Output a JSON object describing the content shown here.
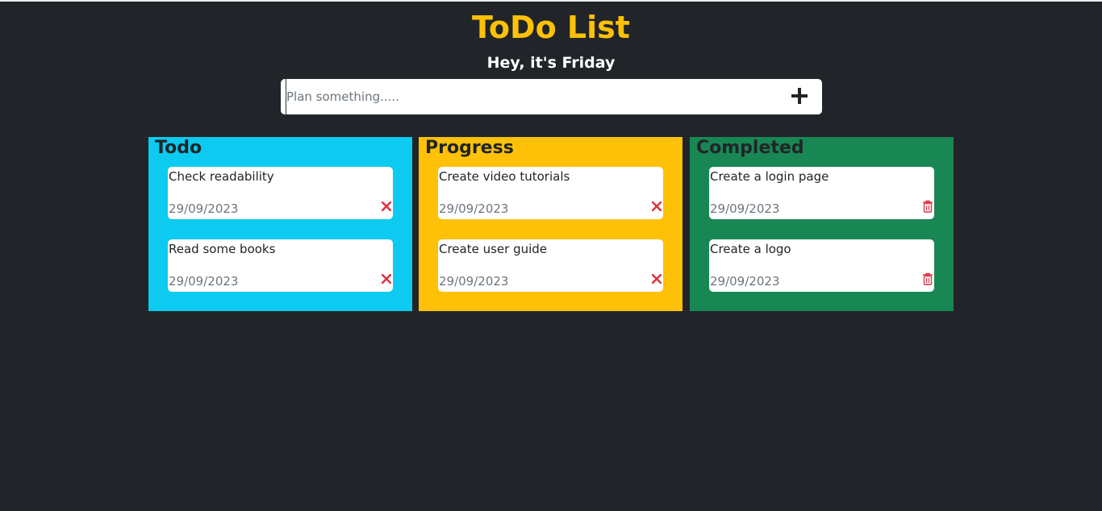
{
  "header": {
    "title": "ToDo List",
    "subtitle": "Hey, it's Friday"
  },
  "add_task": {
    "placeholder": "Plan something.....",
    "value": "",
    "button_icon": "plus-icon"
  },
  "columns": [
    {
      "title": "Todo",
      "color": "#0dcaf0",
      "action_icon": "close-icon",
      "tasks": [
        {
          "text": "Check readability",
          "date": "29/09/2023"
        },
        {
          "text": "Read some books",
          "date": "29/09/2023"
        }
      ]
    },
    {
      "title": "Progress",
      "color": "#ffc107",
      "action_icon": "close-icon",
      "tasks": [
        {
          "text": "Create video tutorials",
          "date": "29/09/2023"
        },
        {
          "text": "Create user guide",
          "date": "29/09/2023"
        }
      ]
    },
    {
      "title": "Completed",
      "color": "#198754",
      "action_icon": "trash-icon",
      "tasks": [
        {
          "text": "Create a login page",
          "date": "29/09/2023"
        },
        {
          "text": "Create a logo",
          "date": "29/09/2023"
        }
      ]
    }
  ],
  "colors": {
    "background": "#212529",
    "accent": "#ffc107",
    "danger": "#dc3545"
  }
}
